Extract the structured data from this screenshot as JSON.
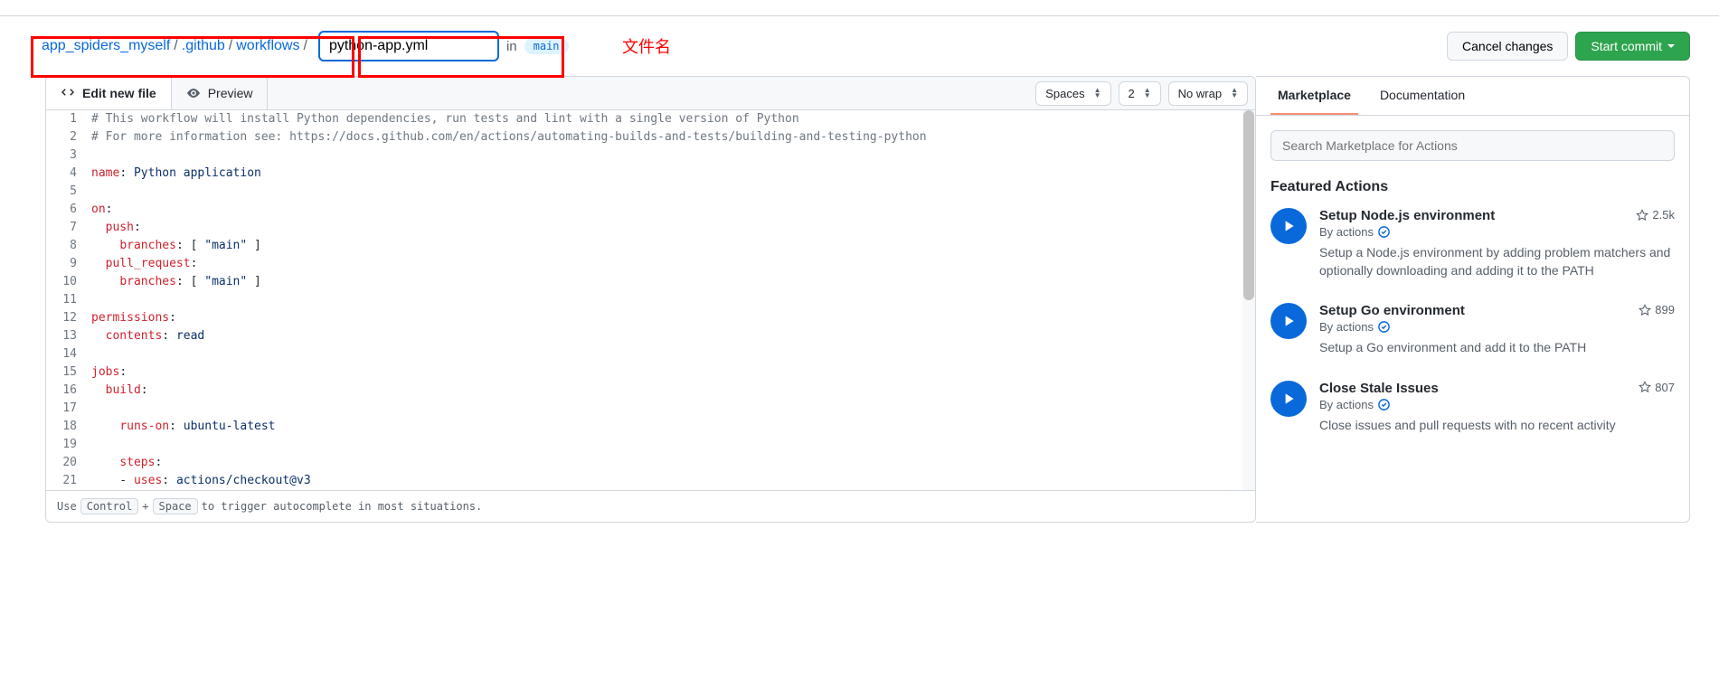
{
  "breadcrumb": {
    "repo": "app_spiders_myself",
    "dir1": ".github",
    "dir2": "workflows",
    "filename": "python-app.yml",
    "in_label": "in",
    "branch": "main"
  },
  "annotation": "文件名",
  "buttons": {
    "cancel": "Cancel changes",
    "commit": "Start commit"
  },
  "tabs": {
    "edit": "Edit new file",
    "preview": "Preview"
  },
  "selects": {
    "indent": "Spaces",
    "size": "2",
    "wrap": "No wrap"
  },
  "code_lines": [
    {
      "n": 1,
      "html": "<span class='tok-comment'># This workflow will install Python dependencies, run tests and lint with a single version of Python</span>"
    },
    {
      "n": 2,
      "html": "<span class='tok-comment'># For more information see: https://docs.github.com/en/actions/automating-builds-and-tests/building-and-testing-python</span>"
    },
    {
      "n": 3,
      "html": ""
    },
    {
      "n": 4,
      "html": "<span class='tok-key'>name</span>: <span class='tok-str'>Python application</span>"
    },
    {
      "n": 5,
      "html": ""
    },
    {
      "n": 6,
      "html": "<span class='tok-key'>on</span>:"
    },
    {
      "n": 7,
      "html": "  <span class='tok-key'>push</span>:"
    },
    {
      "n": 8,
      "html": "    <span class='tok-key'>branches</span>: [ <span class='tok-str'>\"main\"</span> ]"
    },
    {
      "n": 9,
      "html": "  <span class='tok-key'>pull_request</span>:"
    },
    {
      "n": 10,
      "html": "    <span class='tok-key'>branches</span>: [ <span class='tok-str'>\"main\"</span> ]"
    },
    {
      "n": 11,
      "html": ""
    },
    {
      "n": 12,
      "html": "<span class='tok-key'>permissions</span>:"
    },
    {
      "n": 13,
      "html": "  <span class='tok-key'>contents</span>: <span class='tok-str'>read</span>"
    },
    {
      "n": 14,
      "html": ""
    },
    {
      "n": 15,
      "html": "<span class='tok-key'>jobs</span>:"
    },
    {
      "n": 16,
      "html": "  <span class='tok-key'>build</span>:"
    },
    {
      "n": 17,
      "html": ""
    },
    {
      "n": 18,
      "html": "    <span class='tok-key'>runs-on</span>: <span class='tok-str'>ubuntu-latest</span>"
    },
    {
      "n": 19,
      "html": ""
    },
    {
      "n": 20,
      "html": "    <span class='tok-key'>steps</span>:"
    },
    {
      "n": 21,
      "html": "    - <span class='tok-key'>uses</span>: <span class='tok-str'>actions/checkout@v3</span>"
    }
  ],
  "hint": {
    "pre": "Use ",
    "k1": "Control",
    "plus": " + ",
    "k2": "Space",
    "post": " to trigger autocomplete in most situations."
  },
  "side": {
    "tab_market": "Marketplace",
    "tab_docs": "Documentation",
    "search_placeholder": "Search Marketplace for Actions",
    "featured": "Featured Actions",
    "actions": [
      {
        "title": "Setup Node.js environment",
        "by": "By actions",
        "stars": "2.5k",
        "desc": "Setup a Node.js environment by adding problem matchers and optionally downloading and adding it to the PATH"
      },
      {
        "title": "Setup Go environment",
        "by": "By actions",
        "stars": "899",
        "desc": "Setup a Go environment and add it to the PATH"
      },
      {
        "title": "Close Stale Issues",
        "by": "By actions",
        "stars": "807",
        "desc": "Close issues and pull requests with no recent activity"
      }
    ]
  }
}
